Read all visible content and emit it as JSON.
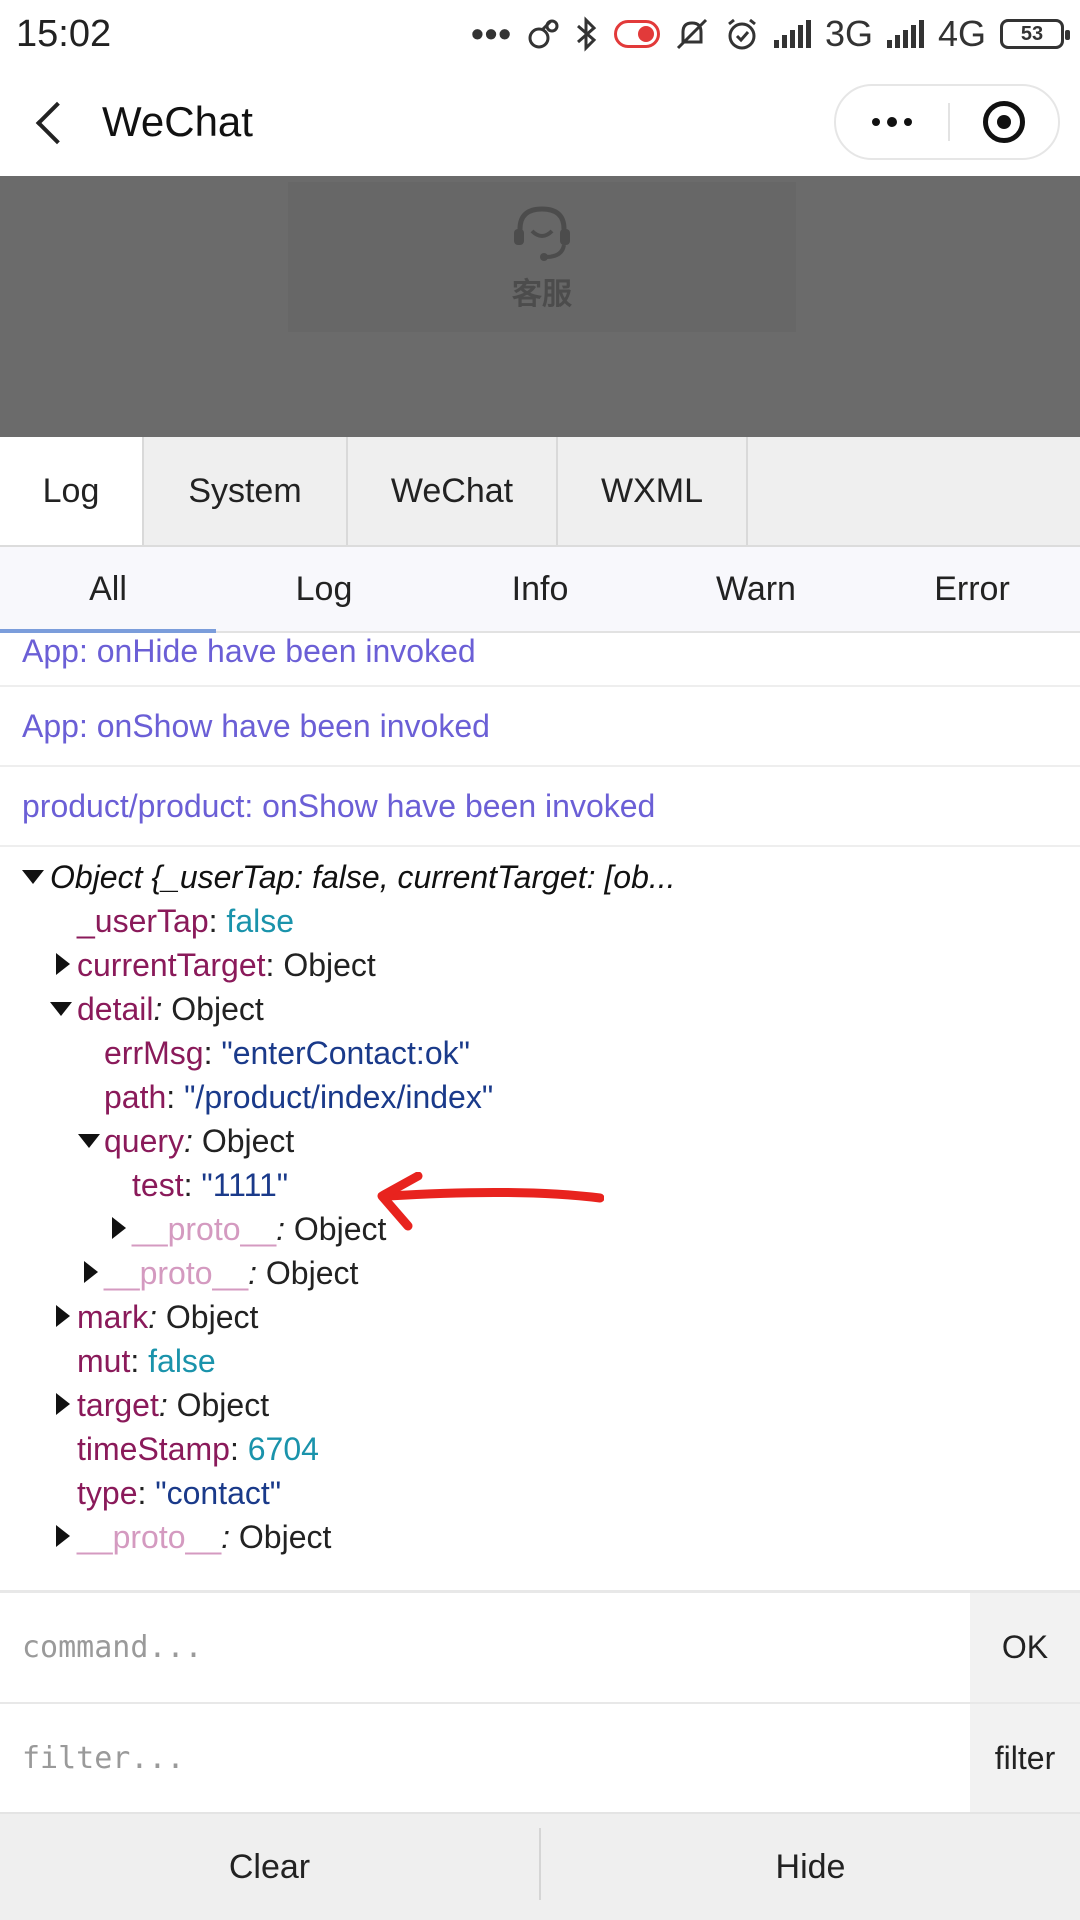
{
  "status_bar": {
    "time": "15:02",
    "dots": "•••",
    "net_3g": "3G",
    "net_4g": "4G",
    "battery": "53"
  },
  "nav": {
    "title": "WeChat"
  },
  "page": {
    "service_label": "客服"
  },
  "tabs": [
    {
      "label": "Log"
    },
    {
      "label": "System"
    },
    {
      "label": "WeChat"
    },
    {
      "label": "WXML"
    }
  ],
  "filters": [
    {
      "label": "All"
    },
    {
      "label": "Log"
    },
    {
      "label": "Info"
    },
    {
      "label": "Warn"
    },
    {
      "label": "Error"
    }
  ],
  "logs": [
    "App: onHide have been invoked",
    "App: onShow have been invoked",
    "product/product: onShow have been invoked"
  ],
  "object": {
    "summary": "Object {_userTap: false, currentTarget: [ob...",
    "rows": {
      "userTap_key": "_userTap",
      "userTap_val": "false",
      "currentTarget_key": "currentTarget",
      "detail_key": "detail",
      "errMsg_key": "errMsg",
      "errMsg_val": "\"enterContact:ok\"",
      "path_key": "path",
      "path_val": "\"/product/index/index\"",
      "query_key": "query",
      "test_key": "test",
      "test_val": "\"1111\"",
      "proto_key": "__proto__",
      "mark_key": "mark",
      "mut_key": "mut",
      "mut_val": "false",
      "target_key": "target",
      "timeStamp_key": "timeStamp",
      "timeStamp_val": "6704",
      "type_key": "type",
      "type_val": "\"contact\"",
      "object_type": "Object",
      "colon": ":"
    }
  },
  "inputs": {
    "command_placeholder": "command...",
    "ok_label": "OK",
    "filter_placeholder": "filter...",
    "filter_label": "filter"
  },
  "bottom": {
    "clear_label": "Clear",
    "hide_label": "Hide"
  },
  "colors": {
    "annotation_arrow": "#e8231e",
    "log_text": "#6b5fd6",
    "object_key": "#8a1a5a",
    "string_value": "#1a3a8a",
    "literal_value": "#1a93ab"
  },
  "icons": {
    "service": "headset-icon",
    "back": "chevron-left-icon",
    "more": "more-dots-icon",
    "close": "target-close-icon"
  }
}
